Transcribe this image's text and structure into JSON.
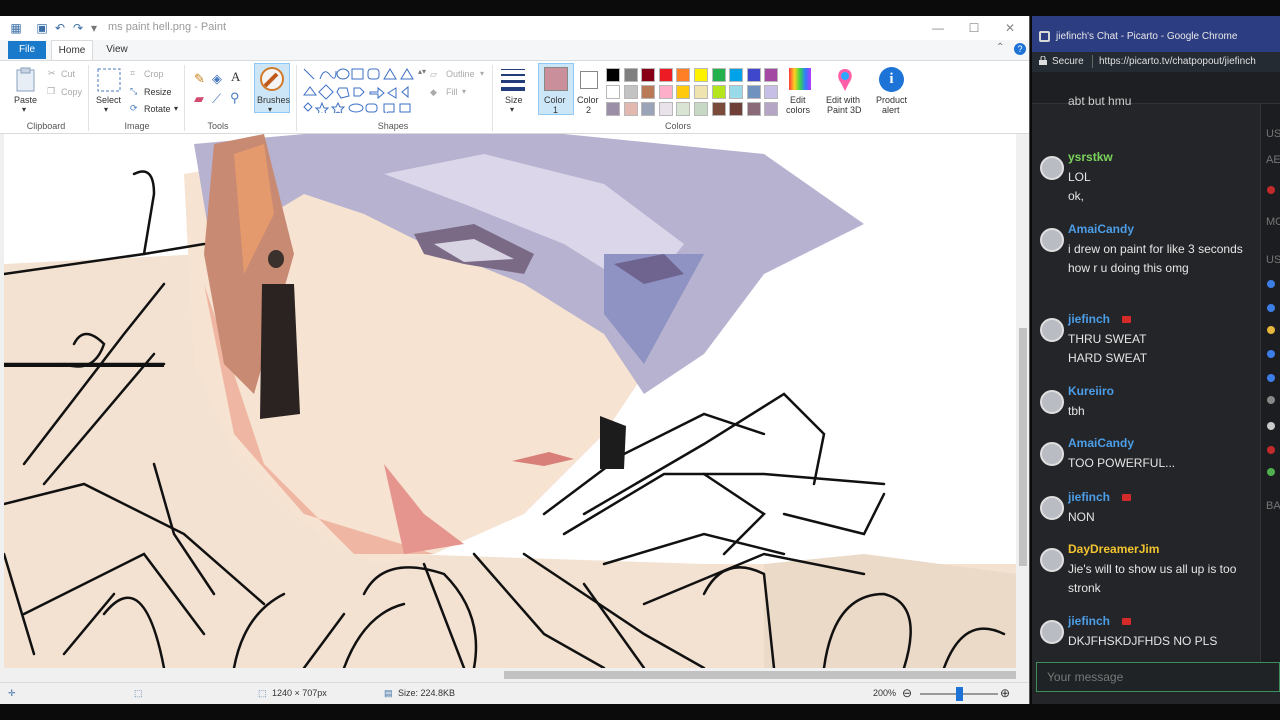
{
  "paint": {
    "window_title": "ms paint hell.png - Paint",
    "tabs": {
      "file": "File",
      "home": "Home",
      "view": "View"
    },
    "clipboard": {
      "paste": "Paste",
      "cut": "Cut",
      "copy": "Copy",
      "group": "Clipboard"
    },
    "image": {
      "select": "Select",
      "crop": "Crop",
      "resize": "Resize",
      "rotate": "Rotate",
      "group": "Image"
    },
    "tools": {
      "group": "Tools",
      "text_tool": "A"
    },
    "brushes": "Brushes",
    "shapes": {
      "outline": "Outline",
      "fill": "Fill",
      "group": "Shapes"
    },
    "size": "Size",
    "color1": {
      "line1": "Color",
      "line2": "1"
    },
    "color2": {
      "line1": "Color",
      "line2": "2"
    },
    "colors_group": "Colors",
    "edit_colors": {
      "line1": "Edit",
      "line2": "colors"
    },
    "edit_3d": {
      "line1": "Edit with",
      "line2": "Paint 3D"
    },
    "product_alert": {
      "line1": "Product",
      "line2": "alert"
    },
    "palette_row1": [
      "#000000",
      "#7f7f7f",
      "#880015",
      "#ed1c24",
      "#ff7f27",
      "#fff200",
      "#22b14c",
      "#00a2e8",
      "#3f48cc",
      "#a349a4"
    ],
    "palette_row2": [
      "#ffffff",
      "#c3c3c3",
      "#b97a57",
      "#ffaec9",
      "#ffc90e",
      "#efe4b0",
      "#b5e61d",
      "#99d9ea",
      "#7092be",
      "#c8bfe7"
    ],
    "palette_row3": [
      "#9b8fa8",
      "#e2b8b0",
      "#9aa3b8",
      "#e9e2ea",
      "#d9e4d5",
      "#c7d8c4",
      "#7a4a3a",
      "#6e4038",
      "#8a6a78",
      "#b5a6c6"
    ],
    "color1_value": "#c98f9b",
    "status": {
      "dimensions": "1240 × 707px",
      "size": "Size: 224.8KB",
      "zoom": "200%"
    }
  },
  "chat": {
    "tab_title": "jiefinch's Chat - Picarto - Google Chrome",
    "secure": "Secure",
    "url": "https://picarto.tv/chatpopout/jiefinch",
    "partial_top": "abt but hmu",
    "messages": [
      {
        "user": "ysrstkw",
        "color": "#7cd35c",
        "lines": [
          "LOL",
          "ok,"
        ]
      },
      {
        "user": "AmaiCandy",
        "color": "#4d9ee8",
        "lines": [
          "i drew on paint for like 3 seconds how r u doing this omg"
        ]
      },
      {
        "user": "jiefinch",
        "color": "#4d9ee8",
        "streamer": true,
        "lines": [
          "THRU SWEAT",
          "HARD SWEAT"
        ]
      },
      {
        "user": "Kureiiro",
        "color": "#4d9ee8",
        "lines": [
          "tbh"
        ]
      },
      {
        "user": "AmaiCandy",
        "color": "#4d9ee8",
        "lines": [
          "TOO POWERFUL..."
        ]
      },
      {
        "user": "jiefinch",
        "color": "#4d9ee8",
        "streamer": true,
        "lines": [
          "NON"
        ]
      },
      {
        "user": "DayDreamerJim",
        "color": "#f3c431",
        "lines": [
          "Jie's will to show us all up is too stronk"
        ]
      },
      {
        "user": "jiefinch",
        "color": "#4d9ee8",
        "streamer": true,
        "lines": [
          "DKJFHSKDJFHDS NO PLS"
        ]
      }
    ],
    "input_placeholder": "Your message",
    "userlist_letters": [
      "US",
      "AE",
      "MO",
      "US",
      "BA"
    ]
  }
}
